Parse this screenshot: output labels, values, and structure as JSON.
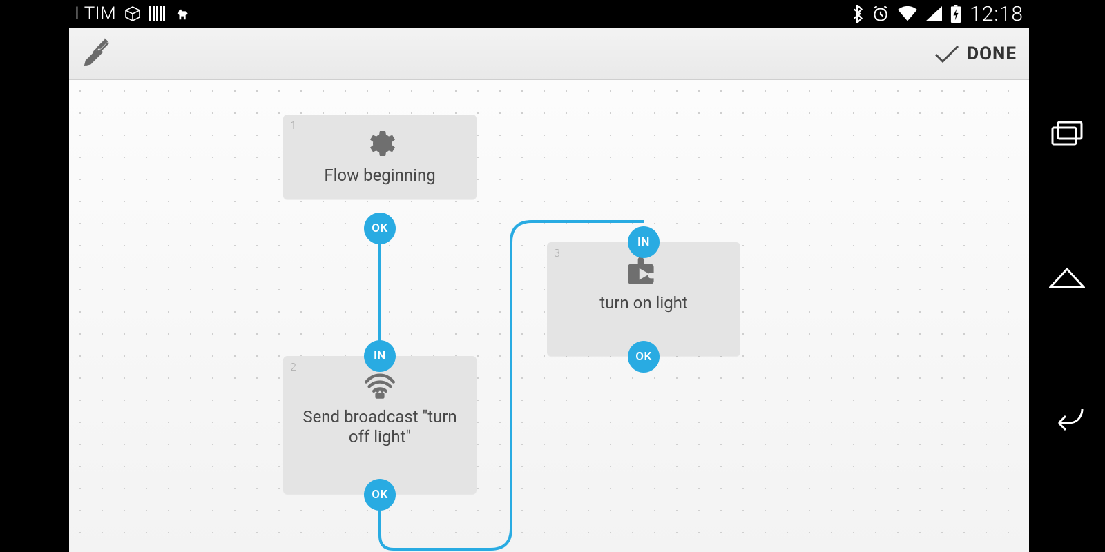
{
  "statusbar": {
    "carrier": "I TIM",
    "clock": "12:18"
  },
  "actionbar": {
    "done_label": "DONE"
  },
  "ports": {
    "in": "IN",
    "ok": "OK"
  },
  "nodes": {
    "n1": {
      "number": "1",
      "label": "Flow beginning"
    },
    "n2": {
      "number": "2",
      "label": "Send broadcast \"turn off light\""
    },
    "n3": {
      "number": "3",
      "label": "turn on light"
    }
  },
  "colors": {
    "accent": "#29abe2",
    "node_bg": "#e4e4e4",
    "text": "#484848"
  }
}
